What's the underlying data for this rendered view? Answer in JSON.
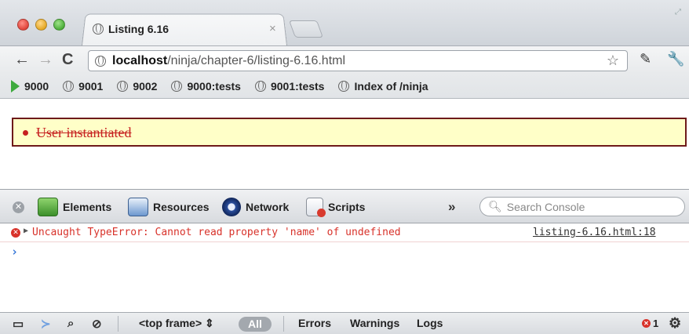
{
  "tab": {
    "title": "Listing 6.16",
    "close": "×"
  },
  "toolbar": {
    "back": "←",
    "forward": "→",
    "reload": "C",
    "url_host": "localhost",
    "url_path": "/ninja/chapter-6/listing-6.16.html",
    "star": "☆",
    "extension": "✎",
    "wrench": "🔧"
  },
  "bookmarks": [
    {
      "label": "9000",
      "icon": "play-icon"
    },
    {
      "label": "9001",
      "icon": "globe-icon"
    },
    {
      "label": "9002",
      "icon": "globe-icon"
    },
    {
      "label": "9000:tests",
      "icon": "globe-icon"
    },
    {
      "label": "9001:tests",
      "icon": "globe-icon"
    },
    {
      "label": "Index of /ninja",
      "icon": "globe-icon"
    }
  ],
  "page": {
    "result_text": "User instantiated"
  },
  "devtools": {
    "panels": [
      "Elements",
      "Resources",
      "Network",
      "Scripts"
    ],
    "overflow": "»",
    "search_placeholder": "Search Console",
    "console": {
      "error_message": "Uncaught TypeError: Cannot read property 'name' of undefined",
      "error_source": "listing-6.16.html:18",
      "prompt": "›"
    },
    "status": {
      "frame": "<top frame>",
      "frame_arrows": "⇕",
      "all": "All",
      "errors": "Errors",
      "warnings": "Warnings",
      "logs": "Logs",
      "error_count": "1"
    }
  },
  "colors": {
    "result_bg": "#ffffc8",
    "result_border": "#6e1a1a",
    "error_red": "#d8322a",
    "prompt_blue": "#2a6fd6"
  }
}
